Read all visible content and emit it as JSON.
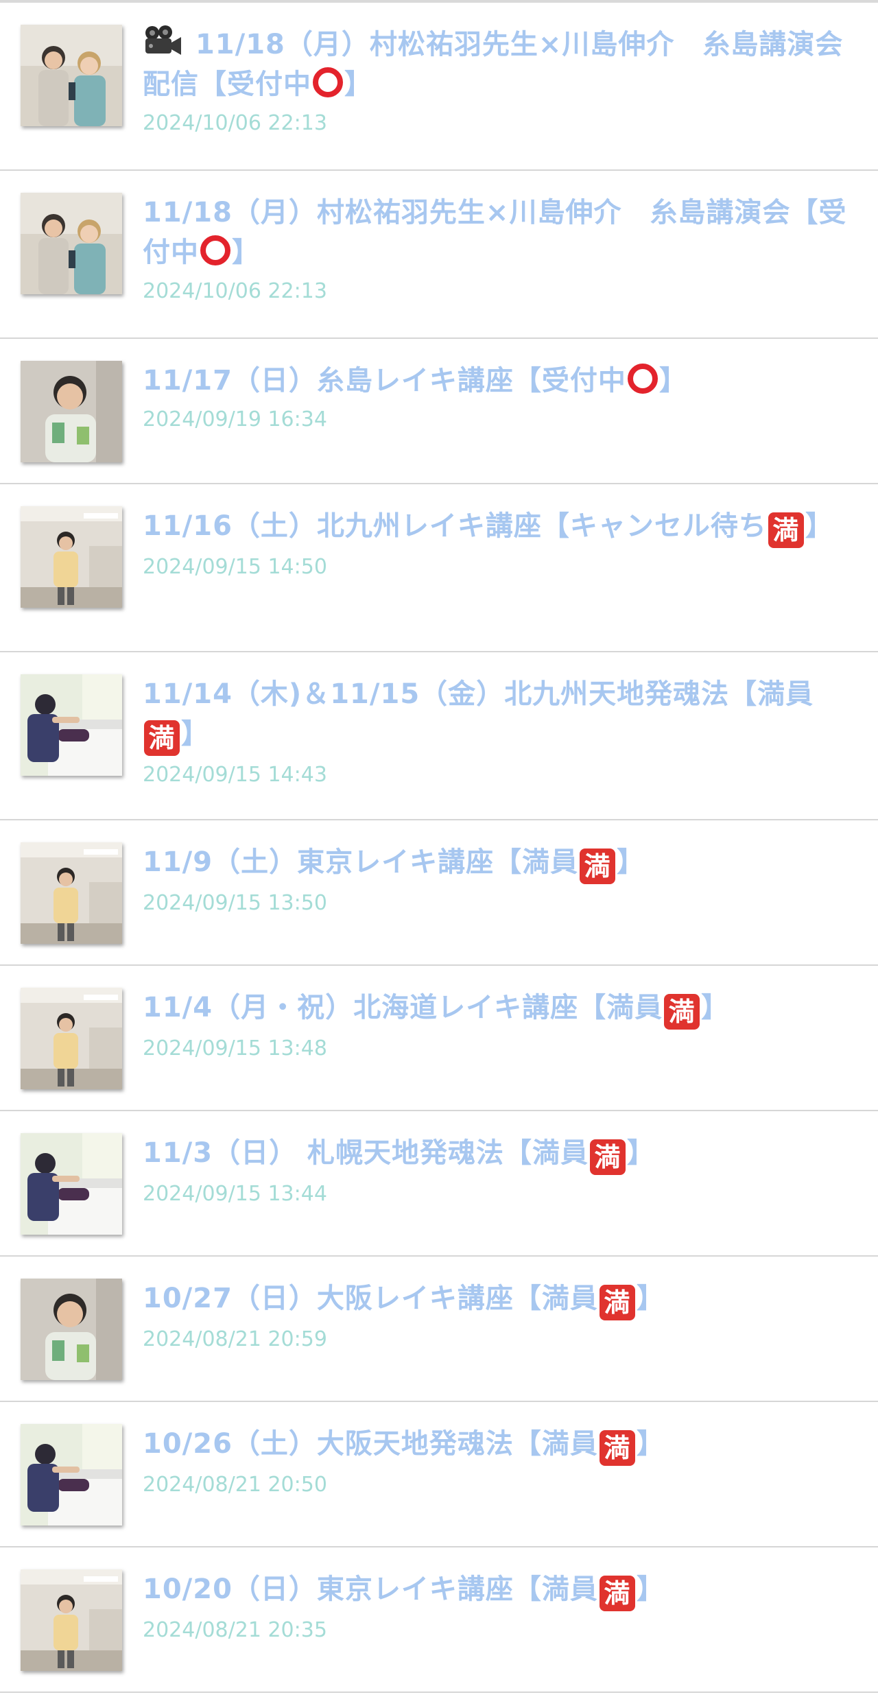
{
  "entries": [
    {
      "title_before": "11/18（月）村松祐羽先生×川島伸介　糸島講演会配信【受付中",
      "status_icon": "circle",
      "title_after": "】",
      "prefix_icon": "video-camera-icon",
      "date": "2024/10/06 22:13",
      "thumb": "two-people"
    },
    {
      "title_before": "11/18（月）村松祐羽先生×川島伸介　糸島講演会【受付中",
      "status_icon": "circle",
      "title_after": "】",
      "prefix_icon": "",
      "date": "2024/10/06 22:13",
      "thumb": "two-people"
    },
    {
      "title_before": "11/17（日）糸島レイキ講座【受付中",
      "status_icon": "circle",
      "title_after": "】",
      "prefix_icon": "",
      "date": "2024/09/19 16:34",
      "thumb": "portrait"
    },
    {
      "title_before": "11/16（土）北九州レイキ講座【キャンセル待ち",
      "status_icon": "full",
      "title_after": "】",
      "prefix_icon": "",
      "date": "2024/09/15 14:50",
      "thumb": "room"
    },
    {
      "title_before": "11/14（木)＆11/15（金）北九州天地発魂法【満員",
      "status_icon": "full",
      "title_after": "】",
      "prefix_icon": "",
      "date": "2024/09/15 14:43",
      "thumb": "treatment"
    },
    {
      "title_before": "11/9（土）東京レイキ講座【満員",
      "status_icon": "full",
      "title_after": "】",
      "prefix_icon": "",
      "date": "2024/09/15 13:50",
      "thumb": "room"
    },
    {
      "title_before": "11/4（月・祝）北海道レイキ講座【満員",
      "status_icon": "full",
      "title_after": "】",
      "prefix_icon": "",
      "date": "2024/09/15 13:48",
      "thumb": "room"
    },
    {
      "title_before": "11/3（日） 札幌天地発魂法【満員",
      "status_icon": "full",
      "title_after": "】",
      "prefix_icon": "",
      "date": "2024/09/15 13:44",
      "thumb": "treatment"
    },
    {
      "title_before": "10/27（日）大阪レイキ講座【満員",
      "status_icon": "full",
      "title_after": "】",
      "prefix_icon": "",
      "date": "2024/08/21 20:59",
      "thumb": "portrait"
    },
    {
      "title_before": "10/26（土）大阪天地発魂法【満員",
      "status_icon": "full",
      "title_after": "】",
      "prefix_icon": "",
      "date": "2024/08/21 20:50",
      "thumb": "treatment"
    },
    {
      "title_before": "10/20（日）東京レイキ講座【満員",
      "status_icon": "full",
      "title_after": "】",
      "prefix_icon": "",
      "date": "2024/08/21 20:35",
      "thumb": "room"
    }
  ],
  "icons": {
    "full_char": "満"
  },
  "colors": {
    "title": "#a7c7f0",
    "date": "#a4dcd6",
    "status_red": "#e0332e",
    "divider": "#d6d6d6"
  }
}
